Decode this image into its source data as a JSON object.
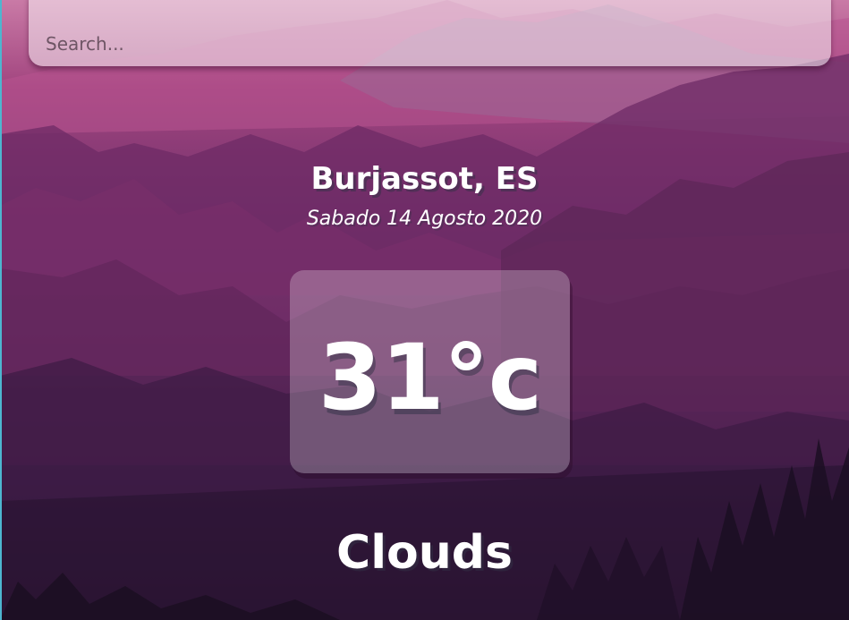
{
  "search": {
    "placeholder": "Search...",
    "value": ""
  },
  "location": {
    "name": "Burjassot, ES",
    "date": "Sabado 14 Agosto 2020"
  },
  "weather": {
    "temperature": "31°c",
    "condition": "Clouds"
  },
  "colors": {
    "sky_top": "#c97aa6",
    "mid": "#7a3470",
    "bottom": "#1d1026",
    "accent_edge": "#4db6d0"
  }
}
